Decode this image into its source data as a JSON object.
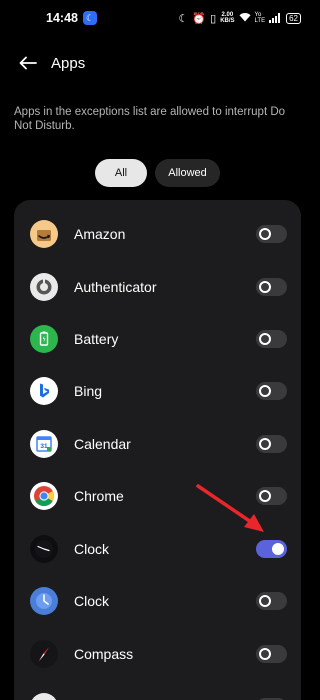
{
  "status_bar": {
    "time": "14:48",
    "speed_value": "2.00",
    "speed_unit": "KB/S",
    "volte_top": "Yo",
    "volte_bottom": "LTE",
    "battery": "62"
  },
  "header": {
    "title": "Apps"
  },
  "description": "Apps in the exceptions list are allowed to interrupt Do Not Disturb.",
  "filters": [
    {
      "label": "All",
      "selected": true
    },
    {
      "label": "Allowed",
      "selected": false
    }
  ],
  "apps": [
    {
      "name": "Amazon",
      "icon": "amazon-icon",
      "enabled": false
    },
    {
      "name": "Authenticator",
      "icon": "authenticator-icon",
      "enabled": false
    },
    {
      "name": "Battery",
      "icon": "battery-icon",
      "enabled": false
    },
    {
      "name": "Bing",
      "icon": "bing-icon",
      "enabled": false
    },
    {
      "name": "Calendar",
      "icon": "calendar-icon",
      "enabled": false
    },
    {
      "name": "Chrome",
      "icon": "chrome-icon",
      "enabled": false
    },
    {
      "name": "Clock",
      "icon": "clock-dark-icon",
      "enabled": true
    },
    {
      "name": "Clock",
      "icon": "clock-blue-icon",
      "enabled": false
    },
    {
      "name": "Compass",
      "icon": "compass-icon",
      "enabled": false
    }
  ],
  "colors": {
    "background": "#000000",
    "card": "#1c1c1e",
    "toggle_on": "#5a63d9",
    "annotation_arrow": "#e8262b"
  }
}
